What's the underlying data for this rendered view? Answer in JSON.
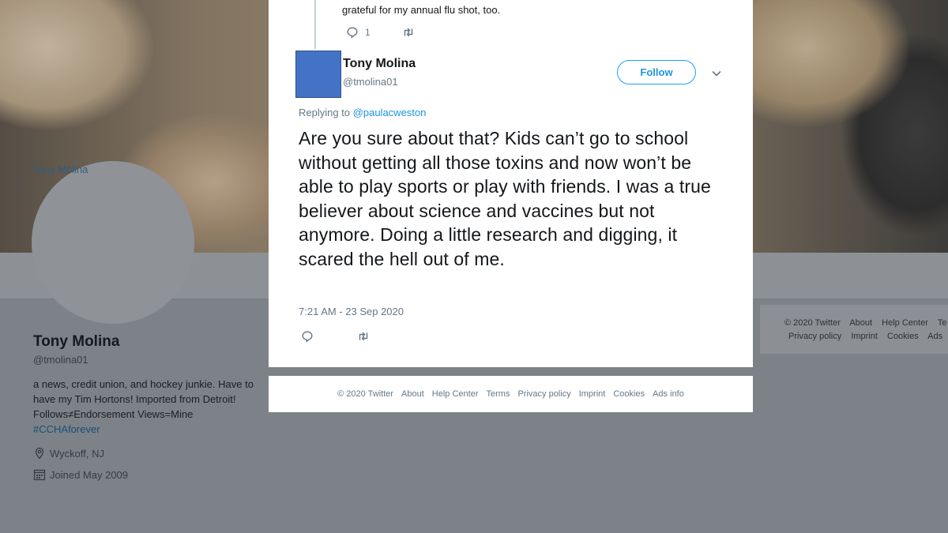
{
  "background_profile": {
    "avatar_alt": "Tony Molina",
    "name": "Tony Molina",
    "handle": "@tmolina01",
    "bio": "a news, credit union, and hockey junkie. Have to have my Tim Hortons! Imported from Detroit! Follows≠Endorsement Views=Mine",
    "bio_hashtag": "#CCHAforever",
    "location": "Wyckoff, NJ",
    "joined": "Joined May 2009",
    "location_icon": "location-pin-icon",
    "calendar_icon": "calendar-icon",
    "side_footer": {
      "row1": [
        "© 2020 Twitter",
        "About",
        "Help Center",
        "Te"
      ],
      "row2": [
        "Privacy policy",
        "Imprint",
        "Cookies",
        "Ads"
      ]
    }
  },
  "previous_tweet": {
    "text_fragment": "grateful for my annual flu shot, too.",
    "reply_count": "1",
    "reply_icon": "reply-icon",
    "retweet_icon": "retweet-icon"
  },
  "tweet": {
    "author_name": "Tony Molina",
    "author_handle": "@tmolina01",
    "follow_label": "Follow",
    "caret_icon": "chevron-down-icon",
    "replying_prefix": "Replying to",
    "replying_to": "@paulacweston",
    "text": "Are you sure about that? Kids can’t go to school without getting all those toxins and now won’t be able to play sports or play with friends. I was a true believer about science and vaccines but not anymore. Doing a little research and digging, it scared the hell out of me.",
    "timestamp": "7:21 AM - 23 Sep 2020",
    "reply_icon": "reply-icon",
    "retweet_icon": "retweet-icon"
  },
  "footer": {
    "links": [
      "© 2020 Twitter",
      "About",
      "Help Center",
      "Terms",
      "Privacy policy",
      "Imprint",
      "Cookies",
      "Ads info"
    ]
  },
  "colors": {
    "accent": "#1da1f2",
    "link": "#1b95e0",
    "avatar_placeholder": "#4472c4",
    "muted_text": "#657786"
  }
}
